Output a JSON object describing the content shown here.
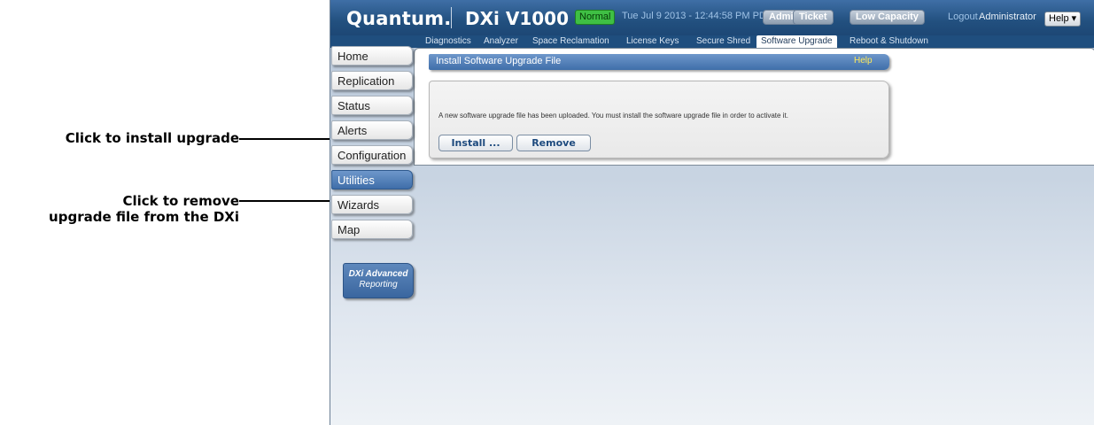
{
  "annotations": {
    "install": "Click to install upgrade",
    "remove_line1": "Click to remove",
    "remove_line2": "upgrade file from the DXi"
  },
  "header": {
    "logo": "Quantum.",
    "product": "DXi V1000",
    "status": "Normal",
    "datetime": "Tue Jul 9 2013 - 12:44:58 PM PDT",
    "pills": [
      "Admin",
      "Ticket",
      "Low Capacity"
    ],
    "logout": "Logout",
    "user": "Administrator",
    "help": "Help ▾"
  },
  "subnav": {
    "tabs": [
      "Diagnostics",
      "Analyzer",
      "Space Reclamation",
      "License Keys",
      "Secure Shred",
      "Software Upgrade",
      "Reboot & Shutdown"
    ],
    "active": "Software Upgrade"
  },
  "sidebar": {
    "items": [
      "Home",
      "Replication",
      "Status",
      "Alerts",
      "Configuration",
      "Utilities",
      "Wizards",
      "Map"
    ],
    "active": "Utilities",
    "advanced_reporting_line1": "DXi Advanced",
    "advanced_reporting_line2": "Reporting"
  },
  "main": {
    "section_title": "Install Software Upgrade File",
    "section_help": "Help",
    "message": "A new software upgrade file has been uploaded. You must install the software upgrade file in order to activate it.",
    "install_button": "Install ...",
    "remove_button": "Remove"
  },
  "colors": {
    "topbar": "#22507f",
    "active_nav": "#3f6ea9",
    "status_badge": "#3fbf44",
    "help_link": "#ffea5a"
  }
}
